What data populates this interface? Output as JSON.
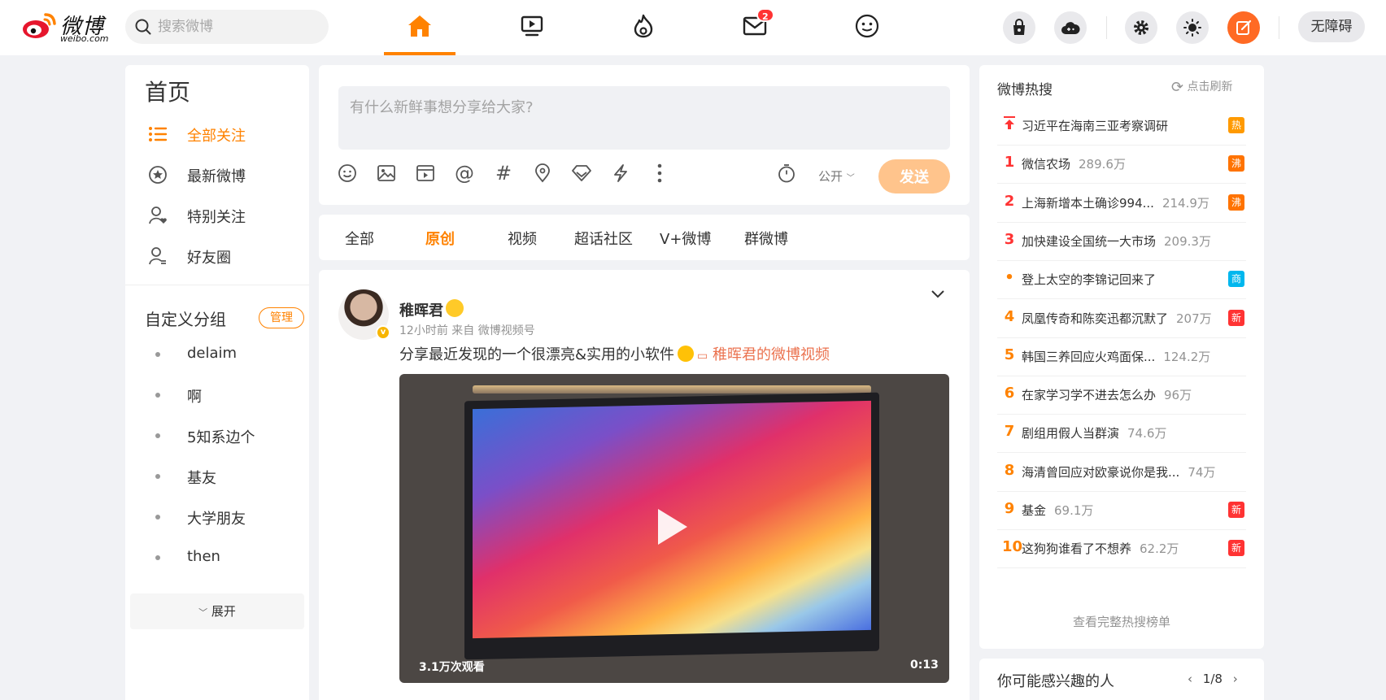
{
  "header": {
    "logo_text": "微博",
    "logo_sub": "weibo.com",
    "search_placeholder": "搜索微博",
    "messages_badge": "2",
    "accessibility": "无障碍"
  },
  "left": {
    "title": "首页",
    "nav": [
      {
        "label": "全部关注",
        "active": true
      },
      {
        "label": "最新微博"
      },
      {
        "label": "特别关注"
      },
      {
        "label": "好友圈"
      }
    ],
    "group_title": "自定义分组",
    "manage_label": "管理",
    "groups": [
      "delaim",
      "啊",
      "5知系边个",
      "基友",
      "大学朋友",
      "then"
    ],
    "expand_label": "展开"
  },
  "compose": {
    "placeholder": "有什么新鲜事想分享给大家?",
    "visibility": "公开",
    "send": "发送"
  },
  "tabs": [
    "全部",
    "原创",
    "视频",
    "超话社区",
    "V+微博",
    "群微博"
  ],
  "post": {
    "author": "稚晖君",
    "meta": "12小时前  来自 微博视频号",
    "text": "分享最近发现的一个很漂亮&实用的小软件",
    "link": "稚晖君的微博视频",
    "views": "3.1万次观看",
    "duration": "0:13"
  },
  "hot": {
    "title": "微博热搜",
    "refresh": "点击刷新",
    "more": "查看完整热搜榜单",
    "items": [
      {
        "rank": "top",
        "word": "习近平在海南三亚考察调研",
        "heat": "",
        "tag": "热",
        "tagtype": "hot1"
      },
      {
        "rank": "1",
        "word": "微信农场",
        "heat": "289.6万",
        "tag": "沸",
        "tagtype": "boil"
      },
      {
        "rank": "2",
        "word": "上海新增本土确诊994...",
        "heat": "214.9万",
        "tag": "沸",
        "tagtype": "boil"
      },
      {
        "rank": "3",
        "word": "加快建设全国统一大市场",
        "heat": "209.3万",
        "tag": "",
        "tagtype": ""
      },
      {
        "rank": "•",
        "word": "登上太空的李锦记回来了",
        "heat": "",
        "tag": "商",
        "tagtype": "biz"
      },
      {
        "rank": "4",
        "word": "凤凰传奇和陈奕迅都沉默了",
        "heat": "207万",
        "tag": "新",
        "tagtype": "new"
      },
      {
        "rank": "5",
        "word": "韩国三养回应火鸡面保...",
        "heat": "124.2万",
        "tag": "",
        "tagtype": ""
      },
      {
        "rank": "6",
        "word": "在家学习学不进去怎么办",
        "heat": "96万",
        "tag": "",
        "tagtype": ""
      },
      {
        "rank": "7",
        "word": "剧组用假人当群演",
        "heat": "74.6万",
        "tag": "",
        "tagtype": ""
      },
      {
        "rank": "8",
        "word": "海清曾回应对欧豪说你是我...",
        "heat": "74万",
        "tag": "",
        "tagtype": ""
      },
      {
        "rank": "9",
        "word": "基金",
        "heat": "69.1万",
        "tag": "新",
        "tagtype": "new"
      },
      {
        "rank": "10",
        "word": "这狗狗谁看了不想养",
        "heat": "62.2万",
        "tag": "新",
        "tagtype": "new"
      }
    ]
  },
  "suggest": {
    "title": "你可能感兴趣的人",
    "pager": "1/8"
  },
  "colors": {
    "accent": "#ff8200",
    "link": "#eb7350",
    "hot_red": "#ff3333"
  }
}
